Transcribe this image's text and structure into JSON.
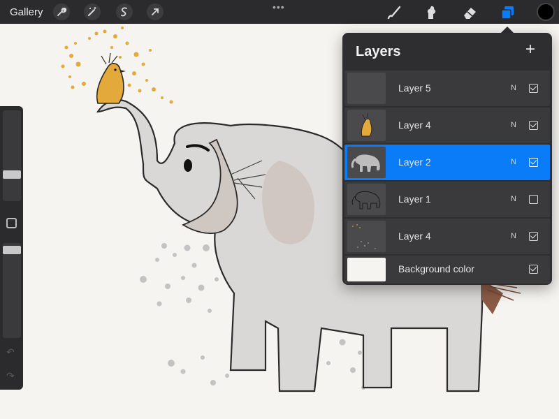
{
  "toolbar": {
    "gallery_label": "Gallery",
    "left_tools": [
      "wrench-icon",
      "magic-wand-icon",
      "selection-icon",
      "transform-arrow-icon"
    ],
    "more_label": "•••",
    "right_tools": [
      "brush-icon",
      "smudge-icon",
      "eraser-icon",
      "layers-icon"
    ],
    "current_color": "#000000",
    "accent_color": "#0a7cf7"
  },
  "sidebar": {
    "brush_size_level": 0.45,
    "opacity_level": 0.05,
    "undo_icon": "undo-arrow-icon",
    "redo_icon": "redo-arrow-icon"
  },
  "layers_panel": {
    "title": "Layers",
    "add_label": "+",
    "layers": [
      {
        "name": "Layer 5",
        "blend": "N",
        "visible": true,
        "selected": false,
        "thumb": "empty"
      },
      {
        "name": "Layer 4",
        "blend": "N",
        "visible": true,
        "selected": false,
        "thumb": "bird"
      },
      {
        "name": "Layer 2",
        "blend": "N",
        "visible": true,
        "selected": true,
        "thumb": "elephant-gray"
      },
      {
        "name": "Layer 1",
        "blend": "N",
        "visible": false,
        "selected": false,
        "thumb": "elephant-sketch"
      },
      {
        "name": "Layer 4",
        "blend": "N",
        "visible": true,
        "selected": false,
        "thumb": "dots"
      }
    ],
    "background": {
      "name": "Background color",
      "visible": true,
      "color": "#f6f4f0"
    }
  }
}
